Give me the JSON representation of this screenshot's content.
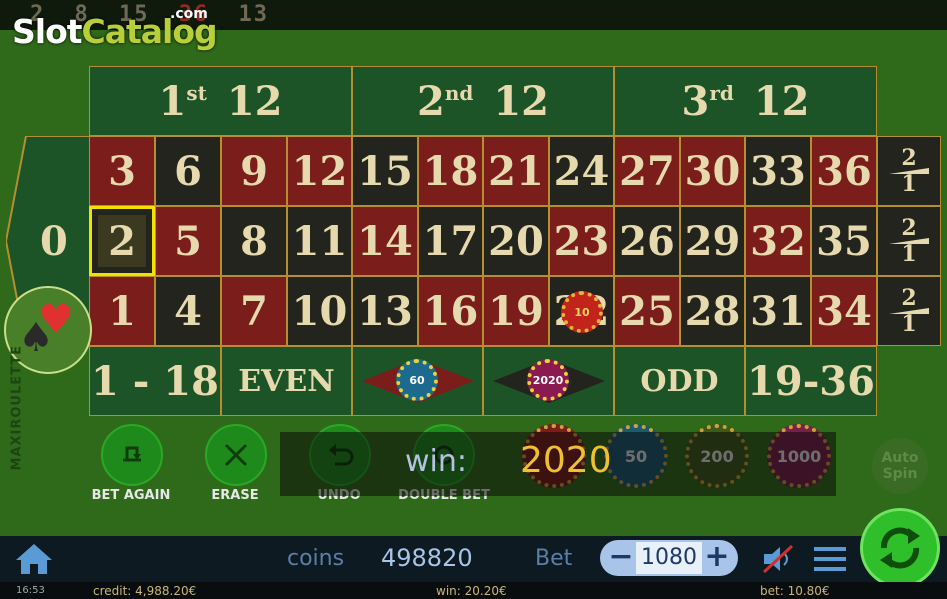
{
  "logo": {
    "part1": "Slot",
    "part2": "Catalog",
    "suffix": ".com"
  },
  "recent_numbers": [
    "2",
    "8",
    "15",
    "36",
    "13"
  ],
  "table": {
    "dozens": [
      {
        "num": "1",
        "sup": "st",
        "label": "12"
      },
      {
        "num": "2",
        "sup": "nd",
        "label": "12"
      },
      {
        "num": "3",
        "sup": "rd",
        "label": "12"
      }
    ],
    "zero": "0",
    "top_row": [
      "3",
      "6",
      "9",
      "12",
      "15",
      "18",
      "21",
      "24",
      "27",
      "30",
      "33",
      "36"
    ],
    "mid_row": [
      "2",
      "5",
      "8",
      "11",
      "14",
      "17",
      "20",
      "23",
      "26",
      "29",
      "32",
      "35"
    ],
    "bot_row": [
      "1",
      "4",
      "7",
      "10",
      "13",
      "16",
      "19",
      "22",
      "25",
      "28",
      "31",
      "34"
    ],
    "column_bet": {
      "top": "2",
      "bottom": "1"
    },
    "outside": [
      "1 - 18",
      "EVEN",
      "",
      "",
      "ODD",
      "19-36"
    ],
    "selected_number": "2"
  },
  "table_chips": [
    {
      "value": "10",
      "on": "22"
    },
    {
      "value": "60",
      "on": "red"
    },
    {
      "value": "2020",
      "on": "black"
    }
  ],
  "side_label": "MAXIROULETTE",
  "controls": [
    {
      "label": "BET AGAIN",
      "icon": "bet-again-icon"
    },
    {
      "label": "ERASE",
      "icon": "close-icon"
    },
    {
      "label": "UNDO",
      "icon": "undo-icon"
    },
    {
      "label": "DOUBLE BET",
      "icon": "double-bet-icon"
    }
  ],
  "chip_values": [
    "50",
    "200",
    "1000"
  ],
  "win": {
    "label": "win:",
    "value": "2020"
  },
  "auto_spin": "Auto Spin",
  "bottom": {
    "coins_label": "coins",
    "coins_value": "498820",
    "bet_label": "Bet",
    "bet_value": "1080",
    "minus": "−",
    "plus": "+"
  },
  "status": {
    "time": "16:53",
    "credit": "credit: 4,988.20€",
    "win": "win: 20.20€",
    "bet": "bet: 10.80€"
  },
  "colors": {
    "felt": "#2f6a1a",
    "red": "#7b1d1a",
    "black": "#23241d",
    "green": "#1c5428",
    "gold": "#e6d9ae",
    "highlight": "#f2e200"
  }
}
